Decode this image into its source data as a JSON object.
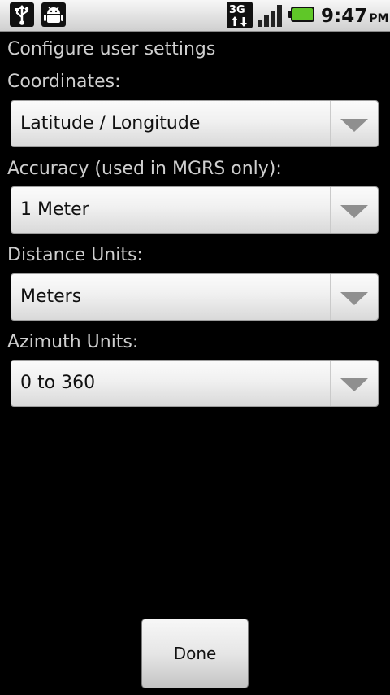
{
  "status_bar": {
    "icons": [
      "usb-icon",
      "android-debug-icon",
      "3g-data-icon",
      "signal-strength-icon",
      "battery-icon"
    ],
    "time": "9:47",
    "ampm": "PM",
    "battery_color": "#5fc728"
  },
  "heading": "Configure user settings",
  "fields": [
    {
      "label": "Coordinates:",
      "value": "Latitude / Longitude"
    },
    {
      "label": "Accuracy (used in MGRS only):",
      "value": "1 Meter"
    },
    {
      "label": "Distance Units:",
      "value": "Meters"
    },
    {
      "label": "Azimuth Units:",
      "value": "0 to 360"
    }
  ],
  "done_label": "Done"
}
